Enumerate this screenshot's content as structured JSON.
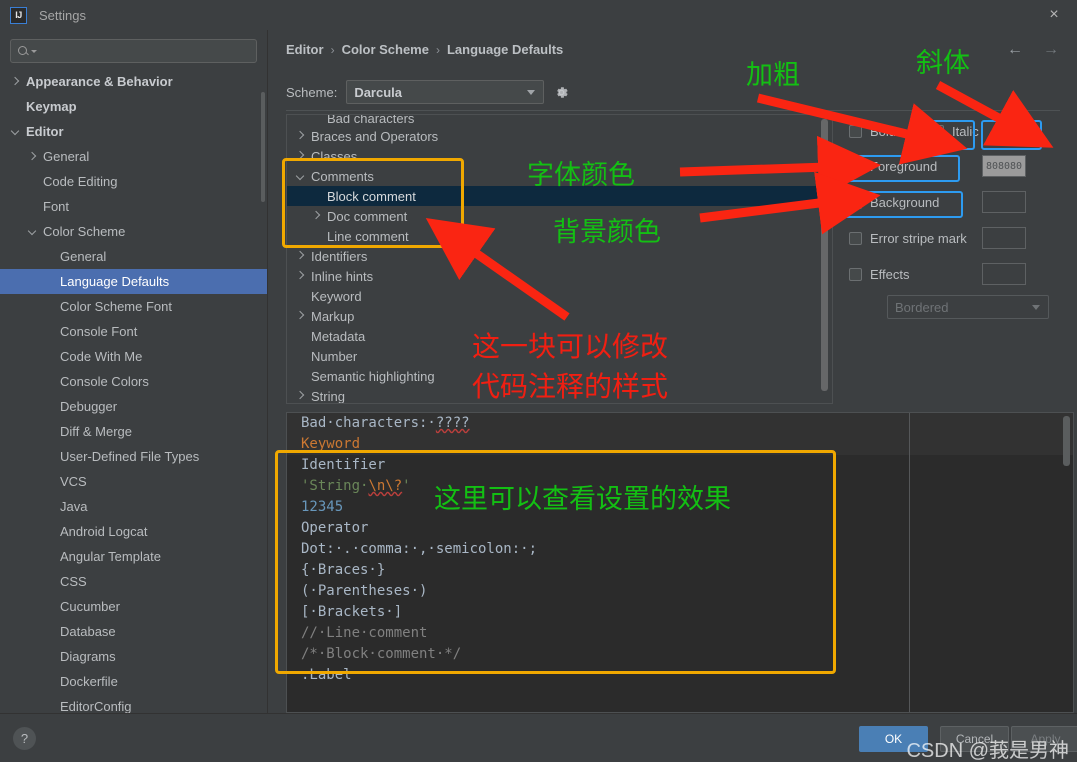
{
  "window": {
    "title": "Settings",
    "logo_text": "IJ",
    "close_icon": "×"
  },
  "sidebar": {
    "search_placeholder": "",
    "items": [
      {
        "label": "Appearance & Behavior",
        "indent": 0,
        "arrow": "right",
        "bold": true,
        "selected": false
      },
      {
        "label": "Keymap",
        "indent": 0,
        "arrow": "none",
        "bold": true,
        "selected": false
      },
      {
        "label": "Editor",
        "indent": 0,
        "arrow": "down",
        "bold": true,
        "selected": false
      },
      {
        "label": "General",
        "indent": 1,
        "arrow": "right",
        "bold": false,
        "selected": false
      },
      {
        "label": "Code Editing",
        "indent": 1,
        "arrow": "none",
        "bold": false,
        "selected": false
      },
      {
        "label": "Font",
        "indent": 1,
        "arrow": "none",
        "bold": false,
        "selected": false
      },
      {
        "label": "Color Scheme",
        "indent": 1,
        "arrow": "down",
        "bold": false,
        "selected": false
      },
      {
        "label": "General",
        "indent": 2,
        "arrow": "none",
        "bold": false,
        "selected": false
      },
      {
        "label": "Language Defaults",
        "indent": 2,
        "arrow": "none",
        "bold": false,
        "selected": true
      },
      {
        "label": "Color Scheme Font",
        "indent": 2,
        "arrow": "none",
        "bold": false,
        "selected": false
      },
      {
        "label": "Console Font",
        "indent": 2,
        "arrow": "none",
        "bold": false,
        "selected": false
      },
      {
        "label": "Code With Me",
        "indent": 2,
        "arrow": "none",
        "bold": false,
        "selected": false
      },
      {
        "label": "Console Colors",
        "indent": 2,
        "arrow": "none",
        "bold": false,
        "selected": false
      },
      {
        "label": "Debugger",
        "indent": 2,
        "arrow": "none",
        "bold": false,
        "selected": false
      },
      {
        "label": "Diff & Merge",
        "indent": 2,
        "arrow": "none",
        "bold": false,
        "selected": false
      },
      {
        "label": "User-Defined File Types",
        "indent": 2,
        "arrow": "none",
        "bold": false,
        "selected": false
      },
      {
        "label": "VCS",
        "indent": 2,
        "arrow": "none",
        "bold": false,
        "selected": false
      },
      {
        "label": "Java",
        "indent": 2,
        "arrow": "none",
        "bold": false,
        "selected": false
      },
      {
        "label": "Android Logcat",
        "indent": 2,
        "arrow": "none",
        "bold": false,
        "selected": false
      },
      {
        "label": "Angular Template",
        "indent": 2,
        "arrow": "none",
        "bold": false,
        "selected": false
      },
      {
        "label": "CSS",
        "indent": 2,
        "arrow": "none",
        "bold": false,
        "selected": false
      },
      {
        "label": "Cucumber",
        "indent": 2,
        "arrow": "none",
        "bold": false,
        "selected": false
      },
      {
        "label": "Database",
        "indent": 2,
        "arrow": "none",
        "bold": false,
        "selected": false
      },
      {
        "label": "Diagrams",
        "indent": 2,
        "arrow": "none",
        "bold": false,
        "selected": false
      },
      {
        "label": "Dockerfile",
        "indent": 2,
        "arrow": "none",
        "bold": false,
        "selected": false
      },
      {
        "label": "EditorConfig",
        "indent": 2,
        "arrow": "none",
        "bold": false,
        "selected": false
      }
    ]
  },
  "breadcrumb": {
    "items": [
      "Editor",
      "Color Scheme",
      "Language Defaults"
    ],
    "separator": "›"
  },
  "nav": {
    "back": "←",
    "forward": "→"
  },
  "scheme": {
    "label": "Scheme:",
    "value": "Darcula",
    "gear_icon": "gear-icon"
  },
  "color_tree": {
    "items": [
      {
        "label": "Bad characters",
        "indent": 1,
        "arrow": "none",
        "selected": false,
        "clipped": true
      },
      {
        "label": "Braces and Operators",
        "indent": 0,
        "arrow": "right",
        "selected": false
      },
      {
        "label": "Classes",
        "indent": 0,
        "arrow": "right",
        "selected": false
      },
      {
        "label": "Comments",
        "indent": 0,
        "arrow": "down",
        "selected": false
      },
      {
        "label": "Block comment",
        "indent": 1,
        "arrow": "none",
        "selected": true
      },
      {
        "label": "Doc comment",
        "indent": 1,
        "arrow": "right",
        "selected": false
      },
      {
        "label": "Line comment",
        "indent": 1,
        "arrow": "none",
        "selected": false
      },
      {
        "label": "Identifiers",
        "indent": 0,
        "arrow": "right",
        "selected": false
      },
      {
        "label": "Inline hints",
        "indent": 0,
        "arrow": "right",
        "selected": false
      },
      {
        "label": "Keyword",
        "indent": 0,
        "arrow": "none",
        "selected": false
      },
      {
        "label": "Markup",
        "indent": 0,
        "arrow": "right",
        "selected": false
      },
      {
        "label": "Metadata",
        "indent": 0,
        "arrow": "none",
        "selected": false
      },
      {
        "label": "Number",
        "indent": 0,
        "arrow": "none",
        "selected": false
      },
      {
        "label": "Semantic highlighting",
        "indent": 0,
        "arrow": "none",
        "selected": false
      },
      {
        "label": "String",
        "indent": 0,
        "arrow": "right",
        "selected": false
      }
    ]
  },
  "attributes": {
    "bold": {
      "label": "Bold",
      "checked": false
    },
    "italic": {
      "label": "Italic",
      "checked": false
    },
    "foreground": {
      "label": "Foreground",
      "checked": true,
      "color": "808080"
    },
    "background": {
      "label": "Background",
      "checked": false,
      "color": ""
    },
    "error_stripe_mark": {
      "label": "Error stripe mark",
      "checked": false,
      "color": ""
    },
    "effects": {
      "label": "Effects",
      "checked": false,
      "color": ""
    },
    "effect_type": {
      "value": "Bordered"
    }
  },
  "preview": {
    "lines": [
      {
        "highlight": true,
        "parts": [
          {
            "t": "Bad·characters:·",
            "c": "c-default"
          },
          {
            "t": "????",
            "c": "c-default squiggle"
          }
        ]
      },
      {
        "highlight": true,
        "parts": [
          {
            "t": "Keyword",
            "c": "c-keyword"
          }
        ]
      },
      {
        "highlight": false,
        "parts": [
          {
            "t": "Identifier",
            "c": "c-default"
          }
        ]
      },
      {
        "highlight": false,
        "parts": [
          {
            "t": "'String·",
            "c": "c-string"
          },
          {
            "t": "\\n\\?",
            "c": "c-escape squiggle"
          },
          {
            "t": "'",
            "c": "c-string"
          }
        ]
      },
      {
        "highlight": false,
        "parts": [
          {
            "t": "12345",
            "c": "c-number"
          }
        ]
      },
      {
        "highlight": false,
        "parts": [
          {
            "t": "Operator",
            "c": "c-default"
          }
        ]
      },
      {
        "highlight": false,
        "parts": [
          {
            "t": "Dot:·.·comma:·,·semicolon:·;",
            "c": "c-default"
          }
        ]
      },
      {
        "highlight": false,
        "parts": [
          {
            "t": "{·Braces·}",
            "c": "c-default"
          }
        ]
      },
      {
        "highlight": false,
        "parts": [
          {
            "t": "(·Parentheses·)",
            "c": "c-default"
          }
        ]
      },
      {
        "highlight": false,
        "parts": [
          {
            "t": "[·Brackets·]",
            "c": "c-default"
          }
        ]
      },
      {
        "highlight": false,
        "parts": [
          {
            "t": "//·Line·comment",
            "c": "c-comment"
          }
        ]
      },
      {
        "highlight": false,
        "parts": [
          {
            "t": "/*·Block·comment·*/",
            "c": "c-comment"
          }
        ]
      },
      {
        "highlight": false,
        "parts": [
          {
            "t": ":Label",
            "c": "c-default"
          }
        ]
      }
    ]
  },
  "buttons": {
    "ok": "OK",
    "cancel": "Cancel",
    "apply": "Apply",
    "help": "?"
  },
  "annotations": {
    "bold_label": "加粗",
    "italic_label": "斜体",
    "foreground_label": "字体颜色",
    "background_label": "背景颜色",
    "tree_note_line1": "这一块可以修改",
    "tree_note_line2": "代码注释的样式",
    "preview_note": "这里可以查看设置的效果",
    "watermark": "CSDN @莪是男神"
  },
  "colors": {
    "accent_blue": "#4b6eaf",
    "highlight_yellow": "#f0a800",
    "annotation_green": "#13c013",
    "annotation_red": "#f01f12",
    "arrow_red": "#fa2512",
    "box_blue": "#2d9bf0"
  }
}
